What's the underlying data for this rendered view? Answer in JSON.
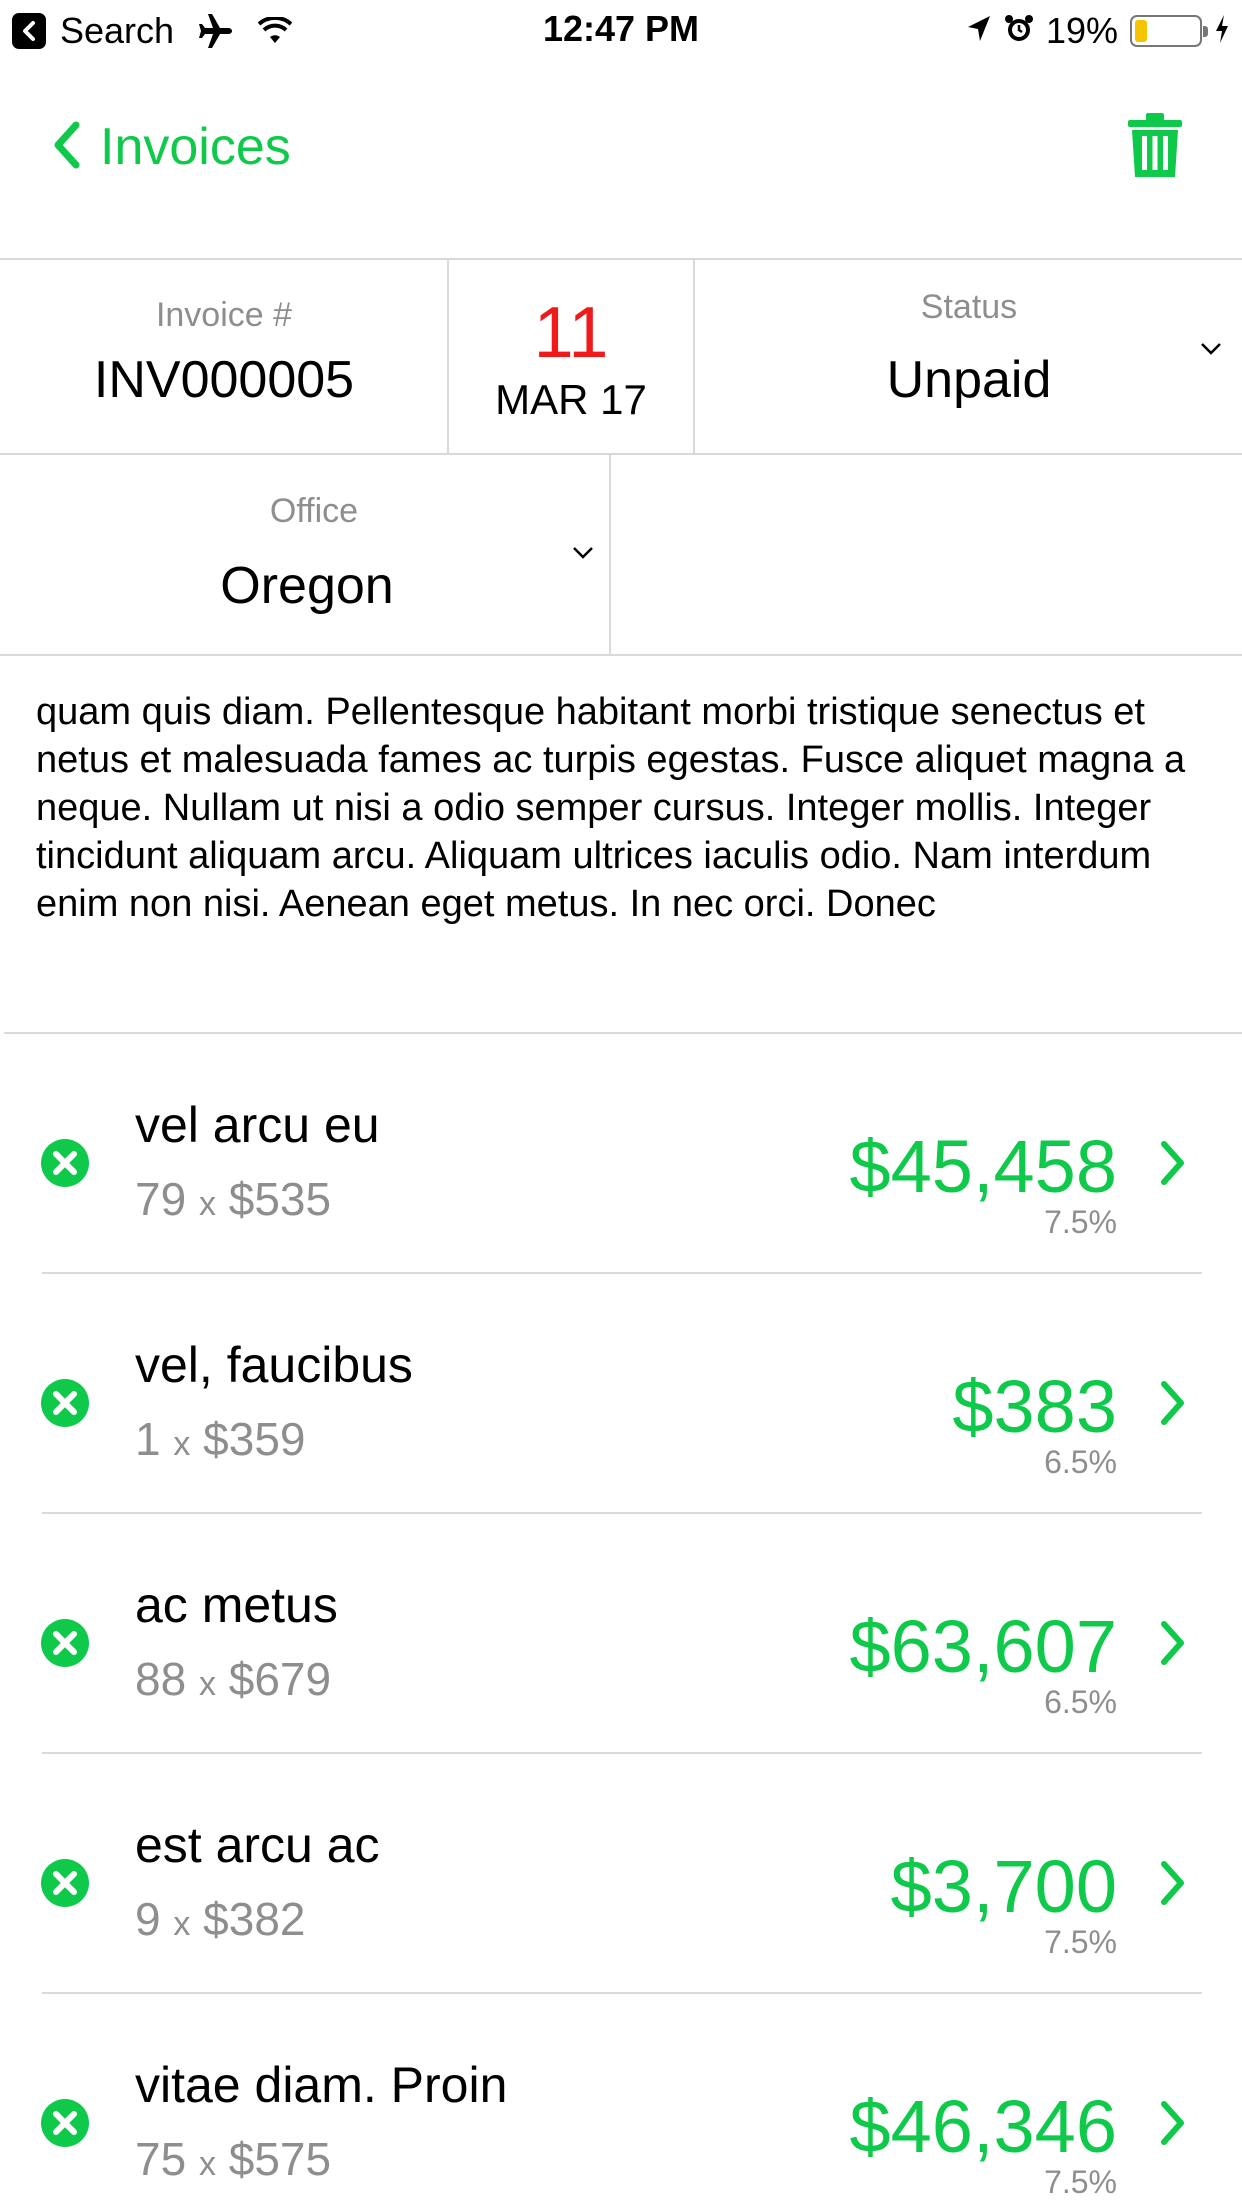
{
  "status_bar": {
    "back_app": "Search",
    "time": "12:47 PM",
    "battery": "19%",
    "battery_level": 0.19,
    "icons": [
      "airplane-icon",
      "wifi-icon",
      "location-icon",
      "alarm-icon",
      "battery-icon",
      "charging-icon"
    ]
  },
  "nav": {
    "back_label": "Invoices",
    "trash_icon": "trash-icon"
  },
  "invoice": {
    "number_label": "Invoice #",
    "number": "INV000005",
    "date_day": "11",
    "date_month": "MAR 17",
    "status_label": "Status",
    "status_value": "Unpaid",
    "office_label": "Office",
    "office_value": "Oregon"
  },
  "notes": "quam quis diam. Pellentesque habitant morbi tristique senectus et netus et malesuada fames ac turpis egestas. Fusce aliquet magna a neque. Nullam ut nisi a odio semper cursus. Integer mollis. Integer tincidunt aliquam arcu. Aliquam ultrices iaculis odio. Nam interdum enim non nisi. Aenean eget metus. In nec orci. Donec",
  "items": [
    {
      "name": "vel arcu eu",
      "qty": "79",
      "x": "x",
      "price": "$535",
      "amount": "$45,458",
      "tax": "7.5%"
    },
    {
      "name": "vel, faucibus",
      "qty": "1",
      "x": "x",
      "price": "$359",
      "amount": "$383",
      "tax": "6.5%"
    },
    {
      "name": "ac metus",
      "qty": "88",
      "x": "x",
      "price": "$679",
      "amount": "$63,607",
      "tax": "6.5%"
    },
    {
      "name": "est arcu ac",
      "qty": "9",
      "x": "x",
      "price": "$382",
      "amount": "$3,700",
      "tax": "7.5%"
    },
    {
      "name": "vitae diam. Proin",
      "qty": "75",
      "x": "x",
      "price": "$575",
      "amount": "$46,346",
      "tax": "7.5%"
    }
  ],
  "colors": {
    "accent": "#0fc94a",
    "date_red": "#ef1a1a",
    "muted": "#8e8e8e",
    "divider": "#d9d9d9"
  }
}
